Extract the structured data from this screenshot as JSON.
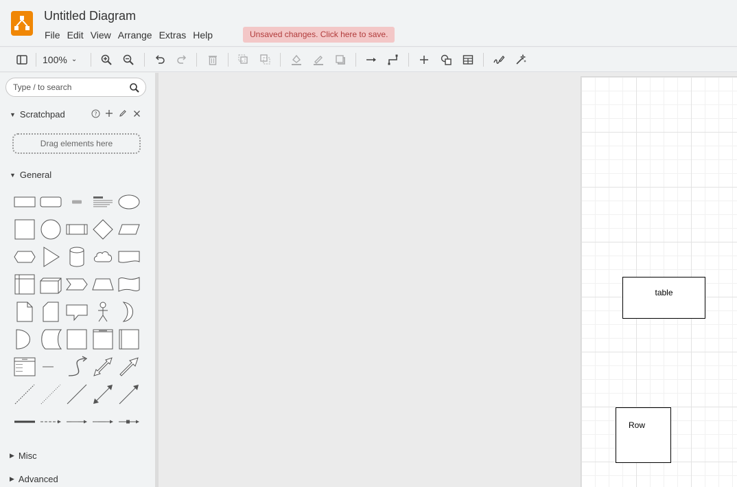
{
  "app": {
    "title": "Untitled Diagram",
    "logo_icon": "drawio-logo-icon",
    "accent_color": "#f08705"
  },
  "menu": [
    "File",
    "Edit",
    "View",
    "Arrange",
    "Extras",
    "Help"
  ],
  "save_notice": "Unsaved changes. Click here to save.",
  "toolbar": {
    "zoom": "100%",
    "icons": [
      "format-panel-icon",
      "zoom-in-icon",
      "zoom-out-icon",
      "undo-icon",
      "redo-icon",
      "delete-icon",
      "to-front-icon",
      "to-back-icon",
      "fill-color-icon",
      "line-color-icon",
      "shadow-icon",
      "connection-icon",
      "waypoints-icon",
      "insert-icon",
      "shapes-icon",
      "table-icon",
      "freehand-icon",
      "ai-generate-icon"
    ]
  },
  "sidebar": {
    "search_placeholder": "Type / to search",
    "scratchpad": {
      "title": "Scratchpad",
      "dropzone": "Drag elements here"
    },
    "general": {
      "title": "General"
    },
    "misc": {
      "title": "Misc"
    },
    "advanced": {
      "title": "Advanced"
    }
  },
  "canvas": {
    "nodes": [
      {
        "label": "table"
      },
      {
        "label": "Row"
      }
    ]
  }
}
